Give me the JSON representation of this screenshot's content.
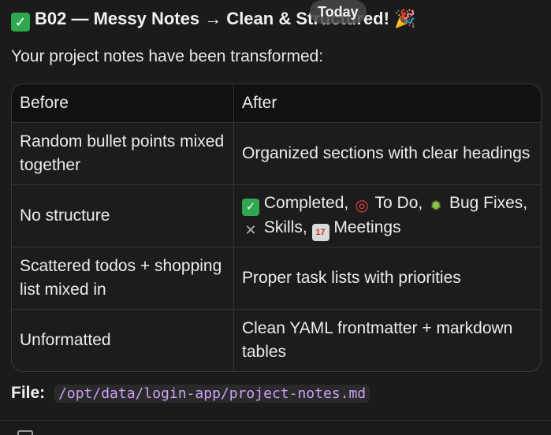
{
  "message": {
    "title": "B02 — Messy Notes → Clean & Structured!",
    "title_emoji_start": "✓",
    "title_emoji_end": "🎉",
    "today_label": "Today",
    "intro": "Your project notes have been transformed:",
    "table": {
      "headers": [
        "Before",
        "After"
      ],
      "rows": [
        {
          "before": "Random bullet points mixed together",
          "after": "Organized sections with clear headings"
        },
        {
          "before": "No structure",
          "after_parts": [
            "Completed,",
            "To Do,",
            "Bug Fixes,",
            "Skills,",
            "Meetings"
          ]
        },
        {
          "before": "Scattered todos + shopping list mixed in",
          "after": "Proper task lists with priorities"
        },
        {
          "before": "Unformatted",
          "after": "Clean YAML frontmatter + markdown tables"
        }
      ]
    },
    "file_label": "File:",
    "file_path": "/opt/data/login-app/project-notes.md"
  },
  "icons": {
    "check": "check-icon",
    "target": "target-icon",
    "bug": "bug-icon",
    "tools": "tools-icon",
    "calendar": "calendar-icon",
    "party": "party-popper-icon"
  },
  "colors": {
    "background": "#1b1b1b",
    "check_green": "#2fa84f",
    "code_text": "#c9a2f7"
  }
}
